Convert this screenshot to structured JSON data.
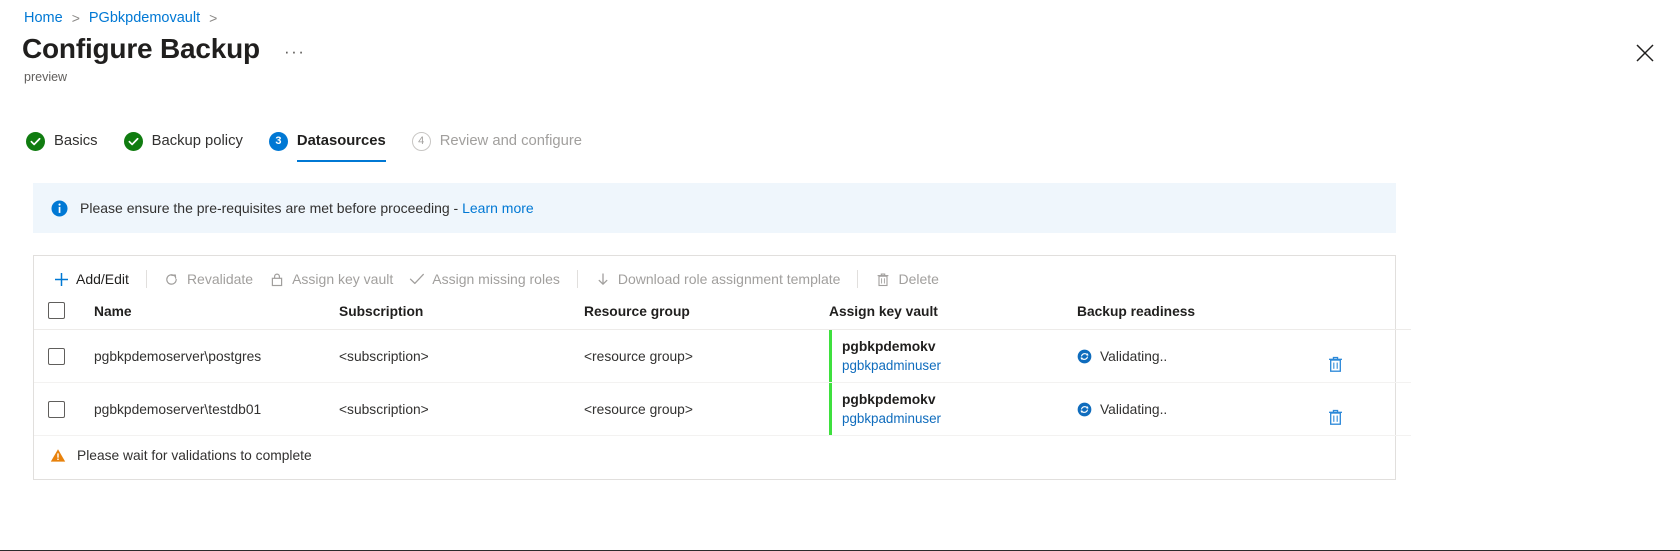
{
  "breadcrumb": {
    "items": [
      {
        "label": "Home"
      },
      {
        "label": "PGbkpdemovault"
      }
    ],
    "separator": ">"
  },
  "header": {
    "title": "Configure Backup",
    "more_label": "···",
    "subtitle": "preview",
    "close_label": "Close",
    "close_icon": "close-icon"
  },
  "wizard": {
    "steps": [
      {
        "badge": "✓",
        "label": "Basics",
        "state": "done"
      },
      {
        "badge": "✓",
        "label": "Backup policy",
        "state": "done"
      },
      {
        "badge": "3",
        "label": "Datasources",
        "state": "active"
      },
      {
        "badge": "4",
        "label": "Review and configure",
        "state": "pending"
      }
    ]
  },
  "info_banner": {
    "icon": "info-icon",
    "text": "Please ensure the pre-requisites are met before proceeding - ",
    "link_label": "Learn more"
  },
  "toolbar": {
    "items": [
      {
        "icon": "plus-icon",
        "label": "Add/Edit",
        "enabled": true
      },
      {
        "icon": "refresh-icon",
        "label": "Revalidate",
        "enabled": false
      },
      {
        "icon": "lock-icon",
        "label": "Assign key vault",
        "enabled": false
      },
      {
        "icon": "check-icon",
        "label": "Assign missing roles",
        "enabled": false
      },
      {
        "icon": "download-icon",
        "label": "Download role assignment template",
        "enabled": false
      },
      {
        "icon": "trash-icon",
        "label": "Delete",
        "enabled": false
      }
    ]
  },
  "table": {
    "select_all_label": "Select all",
    "columns": [
      "Name",
      "Subscription",
      "Resource group",
      "Assign key vault",
      "Backup readiness"
    ],
    "rows": [
      {
        "name": "pgbkpdemoserver\\postgres",
        "subscription": "<subscription>",
        "resource_group": "<resource group>",
        "key_vault": "pgbkpdemokv",
        "key_vault_user": "pgbkpadminuser",
        "readiness": "Validating..",
        "readiness_icon": "sync-icon",
        "delete_icon": "trash-icon"
      },
      {
        "name": "pgbkpdemoserver\\testdb01",
        "subscription": "<subscription>",
        "resource_group": "<resource group>",
        "key_vault": "pgbkpdemokv",
        "key_vault_user": "pgbkpadminuser",
        "readiness": "Validating..",
        "readiness_icon": "sync-icon",
        "delete_icon": "trash-icon"
      }
    ]
  },
  "footer": {
    "icon": "warning-icon",
    "text": "Please wait for validations to complete"
  },
  "colors": {
    "accent": "#0078d4",
    "success": "#107c10",
    "warning": "#e8820c",
    "info_bg": "#eff6fc",
    "kv_bar": "#3ee03e"
  }
}
